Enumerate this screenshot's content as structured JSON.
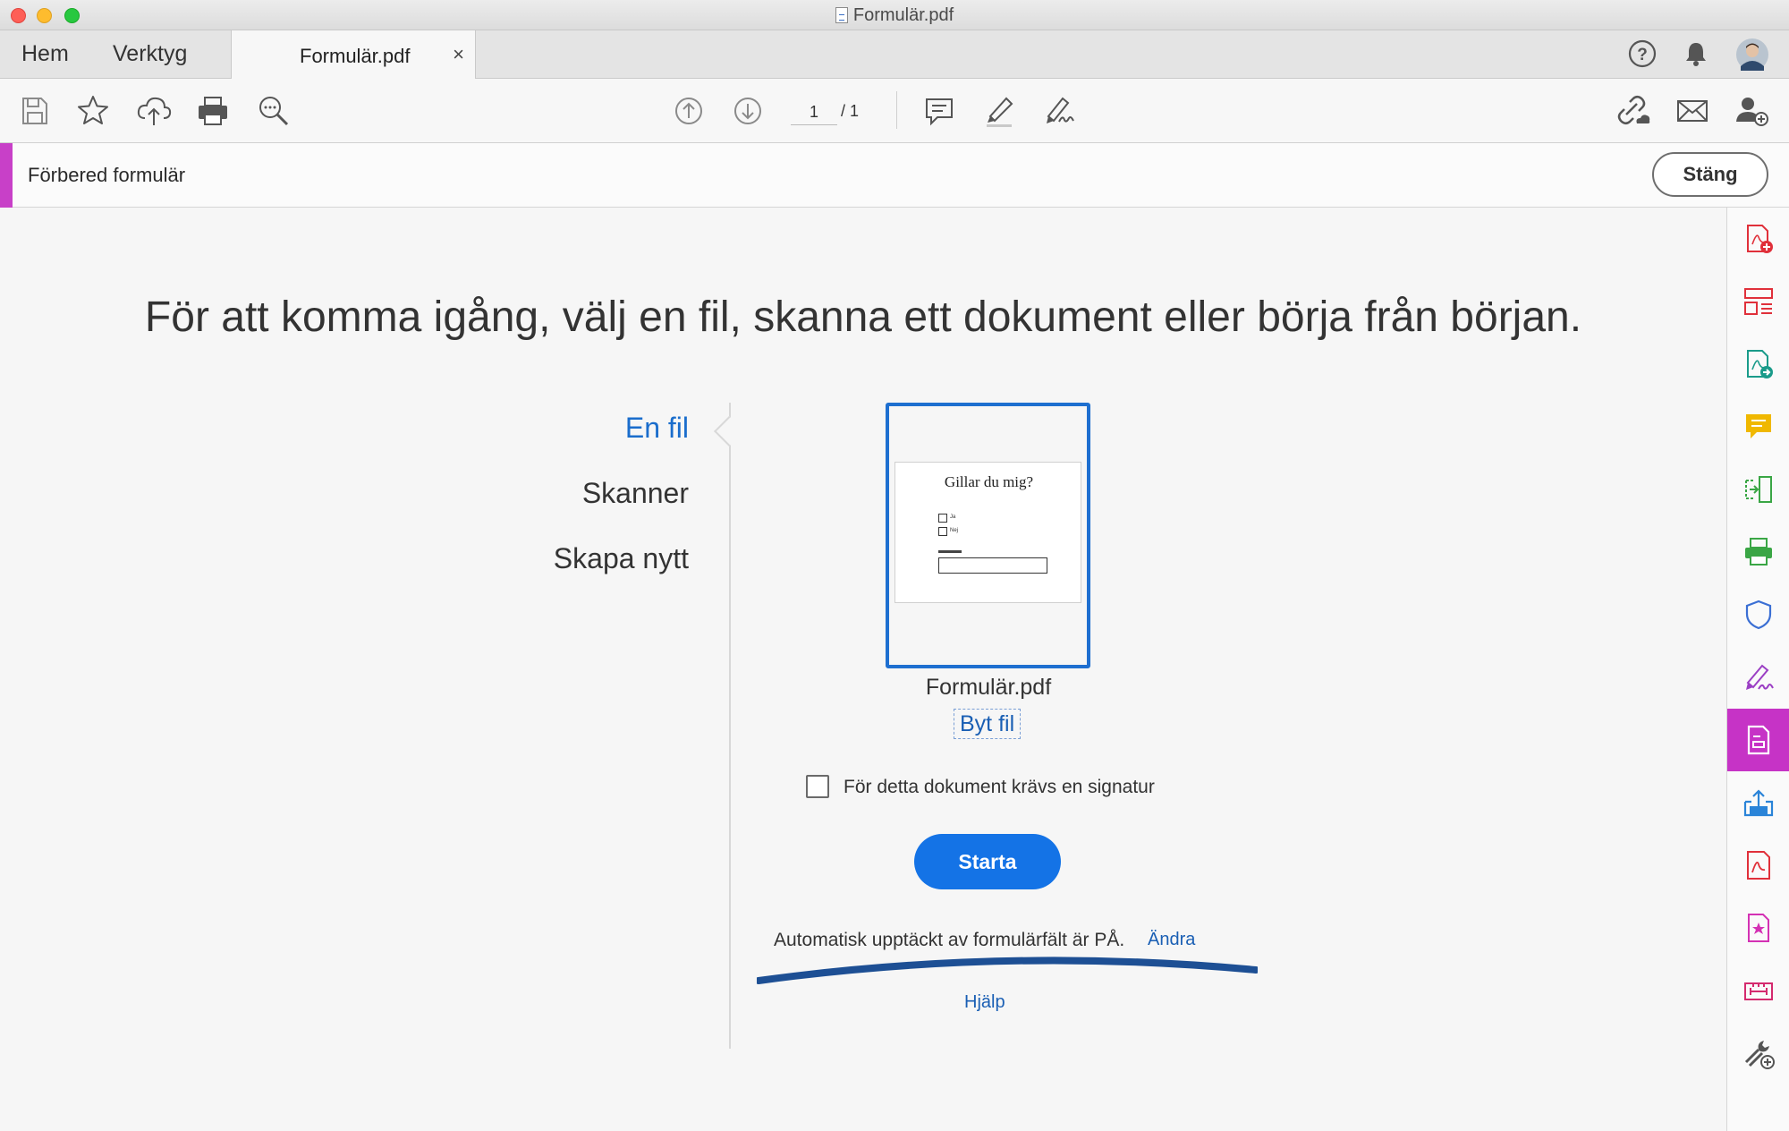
{
  "window": {
    "title": "Formulär.pdf"
  },
  "tabs": {
    "home_label": "Hem",
    "tools_label": "Verktyg",
    "document_label": "Formulär.pdf",
    "close_glyph": "×"
  },
  "toolbar": {
    "page_current": "1",
    "page_total": "/ 1",
    "icons": [
      "save-icon",
      "bookmark-star-icon",
      "cloud-upload-icon",
      "print-icon",
      "zoom-search-icon",
      "page-up-icon",
      "page-down-icon",
      "comment-icon",
      "highlight-pen-icon",
      "sign-pen-icon",
      "share-link-icon",
      "email-icon",
      "add-user-icon"
    ]
  },
  "tool_header": {
    "title": "Förbered formulär",
    "close_label": "Stäng",
    "accent_color": "#c840c8"
  },
  "main": {
    "headline": "För att komma igång, välj en fil, skanna ett dokument eller börja från början.",
    "options": [
      {
        "label": "En fil",
        "active": true
      },
      {
        "label": "Skanner",
        "active": false
      },
      {
        "label": "Skapa nytt",
        "active": false
      }
    ],
    "thumbnail": {
      "page_title": "Gillar du mig?",
      "option_yes": "Ja",
      "option_no": "Nej"
    },
    "file_name": "Formulär.pdf",
    "change_file_label": "Byt fil",
    "signature_checkbox_label": "För detta dokument krävs en signatur",
    "signature_checked": false,
    "start_label": "Starta",
    "autodetect_text": "Automatisk upptäckt av formulärfält är PÅ.",
    "autodetect_change_label": "Ändra",
    "help_label": "Hjälp",
    "accent_blue": "#1473e6"
  },
  "right_rail": {
    "items": [
      "create-pdf-icon",
      "organize-pages-icon",
      "export-pdf-icon",
      "comment-tool-icon",
      "combine-files-icon",
      "scan-ocr-icon",
      "protect-icon",
      "fill-sign-icon",
      "prepare-form-icon",
      "send-review-icon",
      "edit-pdf-icon",
      "request-signature-icon",
      "measure-icon",
      "more-tools-icon"
    ],
    "active_item": "prepare-form-icon",
    "active_color": "#c633c6"
  }
}
